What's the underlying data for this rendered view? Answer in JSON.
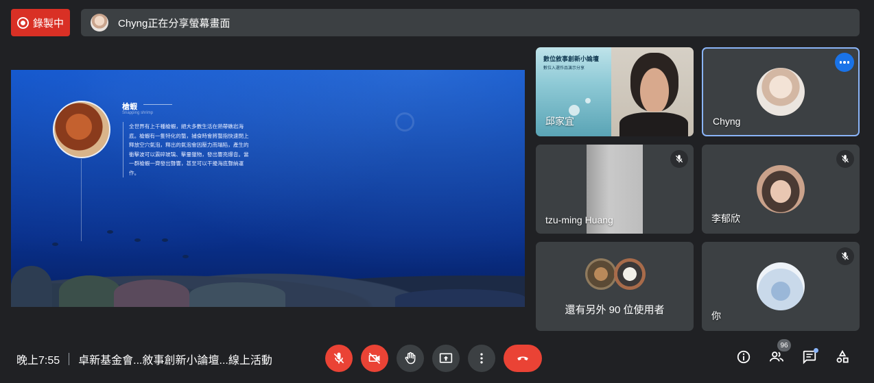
{
  "recording": {
    "label": "錄製中",
    "color": "#d93025"
  },
  "share_banner": {
    "text": "Chyng正在分享螢幕畫面"
  },
  "slide": {
    "title": "槍蝦",
    "subtitle": "Snapping shrimp",
    "body": "全世界有上千種槍蝦，絕大多數生活在熱帶礁岩海底。槍蝦有一隻特化的螯，捕食時會將螯指快速閉上釋放空穴氣泡，釋出的氣泡會因壓力而塌陷，產生的衝擊波可以震碎玻璃、擊暈獵物，發出響亮爆音。當一群槍蝦一齊發出聲響，甚至可以干擾海底聲納運作。"
  },
  "participants": [
    {
      "name": "邱家宜",
      "slide_title": "數位敘事創新小論壇",
      "slide_sub": "數位入選作品演示分享",
      "muted": false
    },
    {
      "name": "Chyng",
      "muted": false,
      "selected": true
    },
    {
      "name": "tzu-ming Huang",
      "muted": true
    },
    {
      "name": "李郁欣",
      "muted": true
    },
    {
      "name": "還有另外 90 位使用者",
      "muted": false
    },
    {
      "name": "你",
      "muted": true
    }
  ],
  "bottom_bar": {
    "time": "晚上7:55",
    "meeting_title": "卓新基金會...敘事創新小論壇...線上活動",
    "controls": [
      "mic-off-icon",
      "camera-off-icon",
      "raise-hand-icon",
      "present-icon",
      "more-vert-icon",
      "hangup-icon"
    ],
    "people_count": "96",
    "right_icons": [
      "info-icon",
      "people-icon",
      "chat-icon",
      "activities-icon"
    ]
  },
  "colors": {
    "background": "#202124",
    "tile": "#3c4043",
    "danger": "#ea4335",
    "accent": "#8ab4f8"
  }
}
